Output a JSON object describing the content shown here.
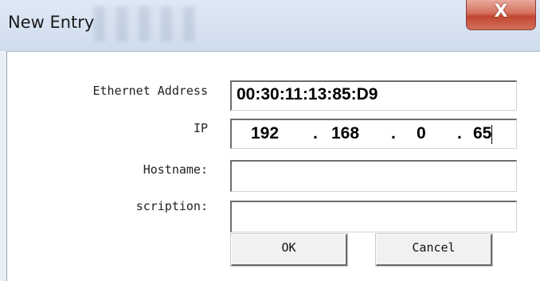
{
  "window": {
    "title": "New Entry",
    "close_glyph": "X"
  },
  "form": {
    "ethernet_label": "Ethernet Address",
    "ethernet_value": "00:30:11:13:85:D9",
    "ip_label": "IP",
    "ip_octets": [
      "192",
      "168",
      "0",
      "65"
    ],
    "ip_dots": [
      ".",
      ".",
      "."
    ],
    "hostname_label": "Hostname:",
    "hostname_value": "",
    "description_label": "scription:",
    "description_value": ""
  },
  "buttons": {
    "ok_label": "OK",
    "cancel_label": "Cancel"
  },
  "icons": {
    "close": "close-icon"
  }
}
